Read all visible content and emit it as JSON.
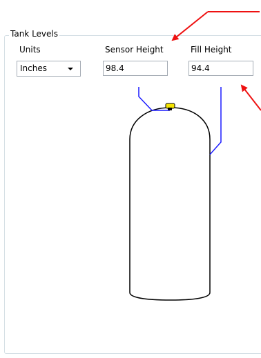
{
  "group": {
    "title": "Tank Levels"
  },
  "units": {
    "label": "Units",
    "value": "Inches"
  },
  "sensor_height": {
    "label": "Sensor Height",
    "value": "98.4"
  },
  "fill_height": {
    "label": "Fill Height",
    "value": "94.4"
  },
  "colors": {
    "annotation_arrow": "#ee1111",
    "level_line": "#1a1aff",
    "sensor_marker": "#f5e400",
    "tank_outline": "#000000",
    "group_border": "#d5dfe5"
  },
  "icons": {
    "dropdown": "chevron-down-icon",
    "sensor": "sensor-marker-icon"
  }
}
